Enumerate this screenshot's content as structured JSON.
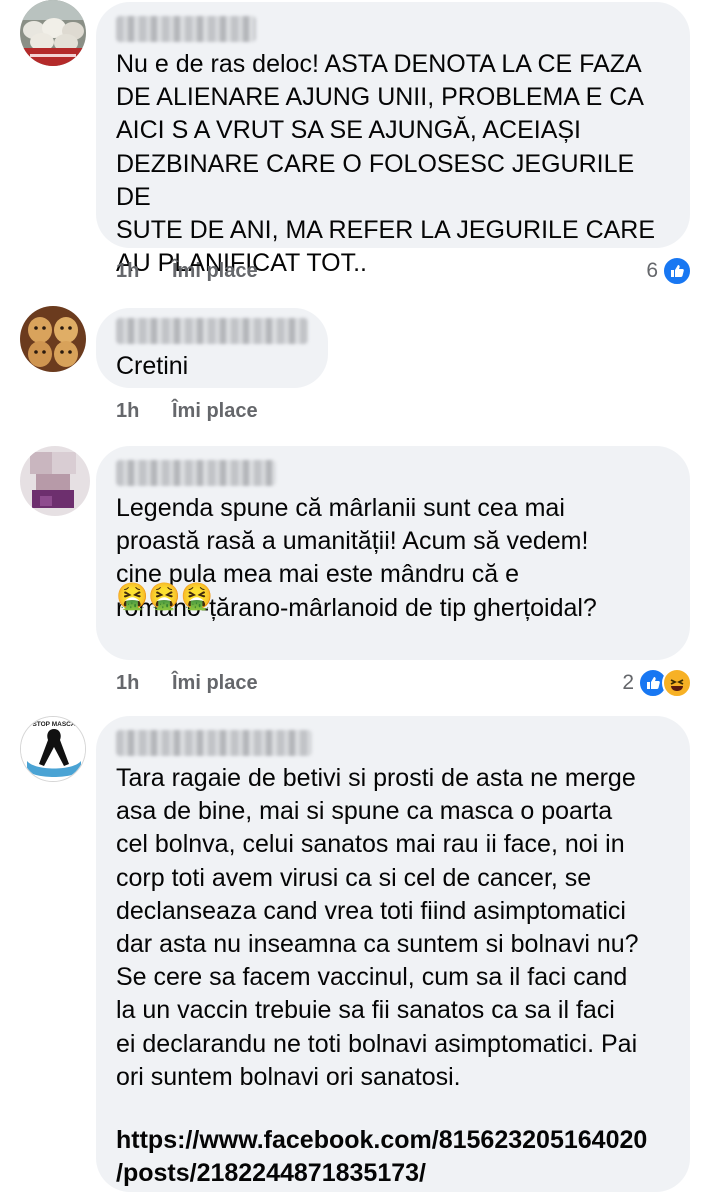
{
  "comments": [
    {
      "text": "Nu e de ras deloc! ASTA DENOTA LA CE FAZA\nDE ALIENARE AJUNG UNII, PROBLEMA E CA\nAICI S A VRUT SA SE AJUNGĂ, ACEIAȘI\nDEZBINARE CARE O FOLOSESC JEGURILE DE\nSUTE DE ANI, MA REFER LA JEGURILE CARE\nAU PLANIFICAT TOT..",
      "time": "1h",
      "like_label": "Îmi place",
      "reaction_count": "6",
      "reactions": [
        "like-icon"
      ]
    },
    {
      "text": "Cretini",
      "time": "1h",
      "like_label": "Îmi place"
    },
    {
      "text": "Legenda spune că mârlanii sunt cea mai\nproastă rasă a umanității! Acum să vedem!\ncine pula mea mai este mândru că e\nromâno-țărano-mârlanoid de tip gherțoidal?",
      "emoji": "🤮🤮🤮",
      "time": "1h",
      "like_label": "Îmi place",
      "reaction_count": "2",
      "reactions": [
        "like-icon",
        "haha-icon"
      ]
    },
    {
      "text": "Tara ragaie de betivi si prosti de asta ne merge\nasa de bine, mai si spune ca masca o poarta\ncel bolnva, celui sanatos mai rau ii face, noi in\ncorp toti avem virusi ca si cel de cancer, se\ndeclanseaza cand vrea toti fiind asimptomatici\ndar asta nu inseamna ca suntem si bolnavi nu?\nSe cere sa facem vaccinul, cum sa il faci cand\nla un vaccin trebuie sa fii sanatos ca sa il faci\nei declarandu ne toti bolnavi asimptomatici. Pai\nori suntem bolnavi ori sanatosi.",
      "link": "https://www.facebook.com/815623205164020\n/posts/2182244871835173/",
      "avatar_text": "STOP MASCA"
    }
  ],
  "colors": {
    "bubble": "#f0f2f5",
    "meta": "#65676b",
    "like": "#1877f2",
    "haha": "#f7b125"
  }
}
